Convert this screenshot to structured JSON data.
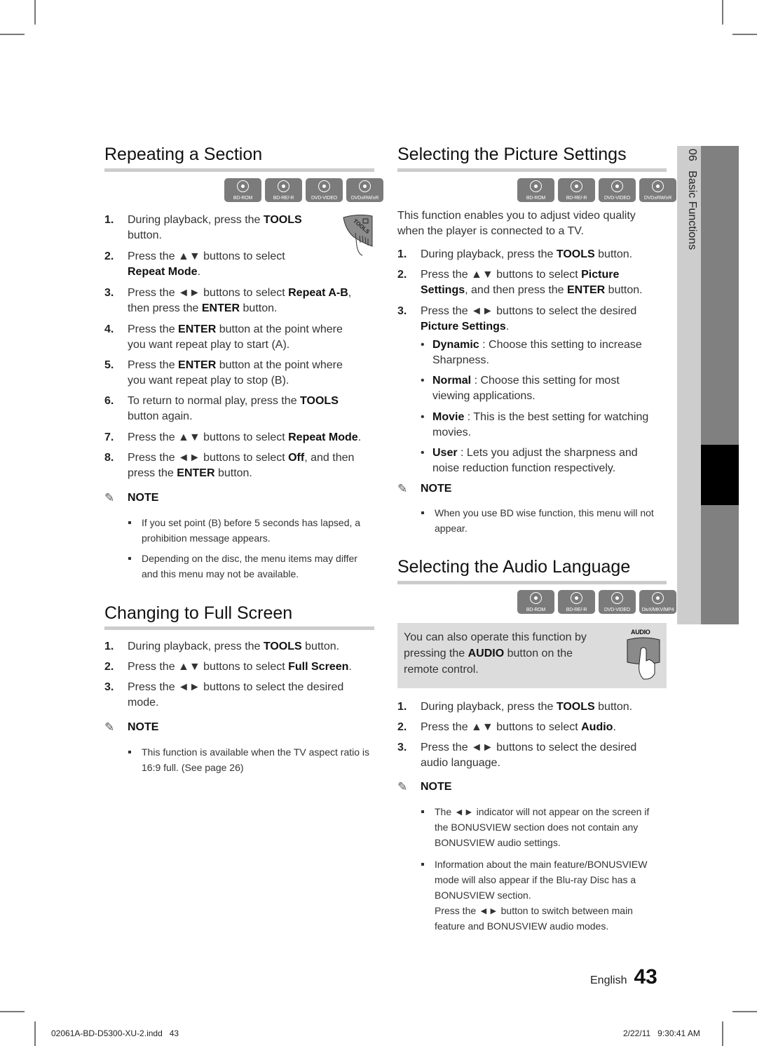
{
  "sidebar": {
    "chapter_number": "06",
    "chapter_title": "Basic Functions"
  },
  "disc_icons": {
    "standard": [
      "BD-ROM",
      "BD-RE/-R",
      "DVD-VIDEO",
      "DVD±RW/±R"
    ],
    "audio_section": [
      "BD-ROM",
      "BD-RE/-R",
      "DVD-VIDEO",
      "DivX/MKV/MP4"
    ]
  },
  "repeating_section": {
    "title": "Repeating a Section",
    "remote_button_label": "TOOLS",
    "steps": [
      {
        "num": "1.",
        "html": "During playback, press the <b>TOOLS</b><br>button."
      },
      {
        "num": "2.",
        "html": "Press the ▲▼ buttons to select<br><b>Repeat Mode</b>."
      },
      {
        "num": "3.",
        "html": "Press the ◄► buttons to select <b>Repeat A-B</b>,<br>then press the <b>ENTER</b> button."
      },
      {
        "num": "4.",
        "html": "Press the <b>ENTER</b> button at the point where<br>you want repeat play to start (A)."
      },
      {
        "num": "5.",
        "html": "Press the <b>ENTER</b> button at the point where<br>you want repeat play to stop (B)."
      },
      {
        "num": "6.",
        "html": "To return to normal play, press the <b>TOOLS</b><br>button again."
      },
      {
        "num": "7.",
        "html": "Press the ▲▼ buttons to select <b>Repeat Mode</b>."
      },
      {
        "num": "8.",
        "html": "Press the ◄► buttons to select <b>Off</b>, and then<br>press the <b>ENTER</b> button."
      }
    ],
    "note_label": "NOTE",
    "notes": [
      "If you set point (B) before 5 seconds has lapsed, a prohibition message appears.",
      "Depending on the disc, the menu items may differ and this menu may not be available."
    ]
  },
  "full_screen": {
    "title": "Changing to Full Screen",
    "steps": [
      {
        "num": "1.",
        "html": "During playback, press the <b>TOOLS</b> button."
      },
      {
        "num": "2.",
        "html": "Press the ▲▼ buttons to select <b>Full Screen</b>."
      },
      {
        "num": "3.",
        "html": "Press the ◄► buttons to select the desired<br>mode."
      }
    ],
    "note_label": "NOTE",
    "notes": [
      "This function is available when the TV aspect ratio is 16:9 full. (See page 26)"
    ]
  },
  "picture_settings": {
    "title": "Selecting the Picture Settings",
    "intro": "This function enables you to adjust video quality when the player is connected to a TV.",
    "steps": [
      {
        "num": "1.",
        "html": "During playback, press the <b>TOOLS</b> button."
      },
      {
        "num": "2.",
        "html": "Press the ▲▼ buttons to select <b>Picture</b><br><b>Settings</b>, and then press the <b>ENTER</b> button."
      },
      {
        "num": "3.",
        "html": "Press the ◄► buttons to select the desired<br><b>Picture Settings</b>."
      }
    ],
    "options": [
      {
        "html": "<b>Dynamic</b> : Choose this setting to increase<br>Sharpness."
      },
      {
        "html": "<b>Normal</b> : Choose this setting for most<br>viewing applications."
      },
      {
        "html": "<b>Movie</b> : This is the best setting for watching<br>movies."
      },
      {
        "html": "<b>User</b> : Lets you adjust the sharpness and<br>noise reduction function respectively."
      }
    ],
    "note_label": "NOTE",
    "notes": [
      "When you use BD wise function, this menu will not appear."
    ]
  },
  "audio_language": {
    "title": "Selecting the Audio Language",
    "tip_html": "You can also operate this function by<br>pressing the <b>AUDIO</b> button on the<br>remote control.",
    "remote_button_label": "AUDIO",
    "steps": [
      {
        "num": "1.",
        "html": "During playback, press the <b>TOOLS</b> button."
      },
      {
        "num": "2.",
        "html": "Press the ▲▼ buttons to select <b>Audio</b>."
      },
      {
        "num": "3.",
        "html": "Press the ◄► buttons to select the desired<br>audio language."
      }
    ],
    "note_label": "NOTE",
    "notes": [
      "The ◄► indicator will not appear on the screen if the BONUSVIEW section does not contain any BONUSVIEW audio settings.",
      "Information about the main feature/BONUSVIEW mode will also appear if the Blu-ray Disc has a BONUSVIEW section.\nPress the ◄► button to switch between main feature and BONUSVIEW audio modes."
    ]
  },
  "page_footer": {
    "language": "English",
    "page_number": "43"
  },
  "print_slug": {
    "file": "02061A-BD-D5300-XU-2.indd   43",
    "date": "2/22/11   9:30:41 AM"
  }
}
